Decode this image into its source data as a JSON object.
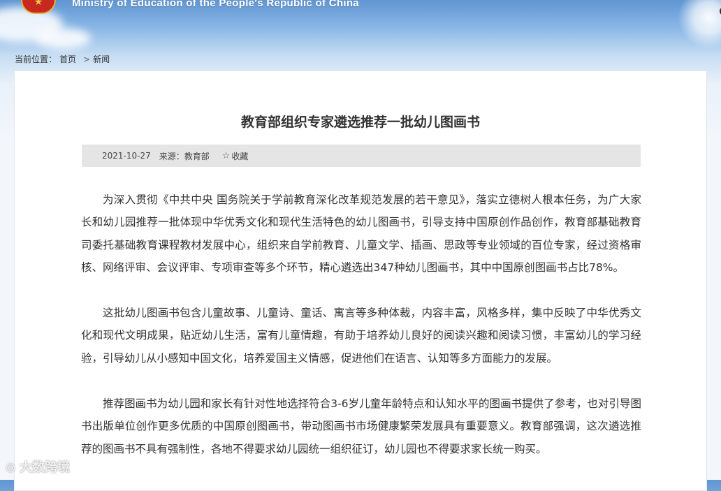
{
  "header": {
    "ministry_name": "Ministry of Education of the People's Republic of China",
    "emblem_icon": "national-emblem-icon"
  },
  "breadcrumb": {
    "prefix": "当前位置：",
    "home": "首页",
    "separator": ">",
    "current": "新闻"
  },
  "article": {
    "title": "教育部组织专家遴选推荐一批幼儿图画书",
    "date": "2021-10-27",
    "source": "来源：教育部",
    "favorite_label": "收藏",
    "favorite_icon": "star-outline-icon",
    "paragraphs": [
      "为深入贯彻《中共中央 国务院关于学前教育深化改革规范发展的若干意见》，落实立德树人根本任务，为广大家长和幼儿园推荐一批体现中华优秀文化和现代生活特色的幼儿图画书，引导支持中国原创作品创作，教育部基础教育司委托基础教育课程教材发展中心，组织来自学前教育、儿童文学、插画、思政等专业领域的百位专家，经过资格审核、网络评审、会议评审、专项审查等多个环节，精心遴选出347种幼儿图画书，其中中国原创图画书占比78%。",
      "这批幼儿图画书包含儿童故事、儿童诗、童话、寓言等多种体裁，内容丰富，风格多样，集中反映了中华优秀文化和现代文明成果，贴近幼儿生活，富有儿童情趣，有助于培养幼儿良好的阅读兴趣和阅读习惯，丰富幼儿的学习经验，引导幼儿从小感知中国文化，培养爱国主义情感，促进他们在语言、认知等多方面能力的发展。",
      "推荐图画书为幼儿园和家长有针对性地选择符合3-6岁儿童年龄特点和认知水平的图画书提供了参考，也对引导图书出版单位创作更多优质的中国原创图画书，带动图画书市场健康繁荣发展具有重要意义。教育部强调，这次遴选推荐的图画书不具有强制性，各地不得要求幼儿园统一组织征订，幼儿园也不得要求家长统一购买。"
    ]
  },
  "watermark": {
    "text": "大数跨境",
    "icon": "weibo-logo-icon"
  }
}
